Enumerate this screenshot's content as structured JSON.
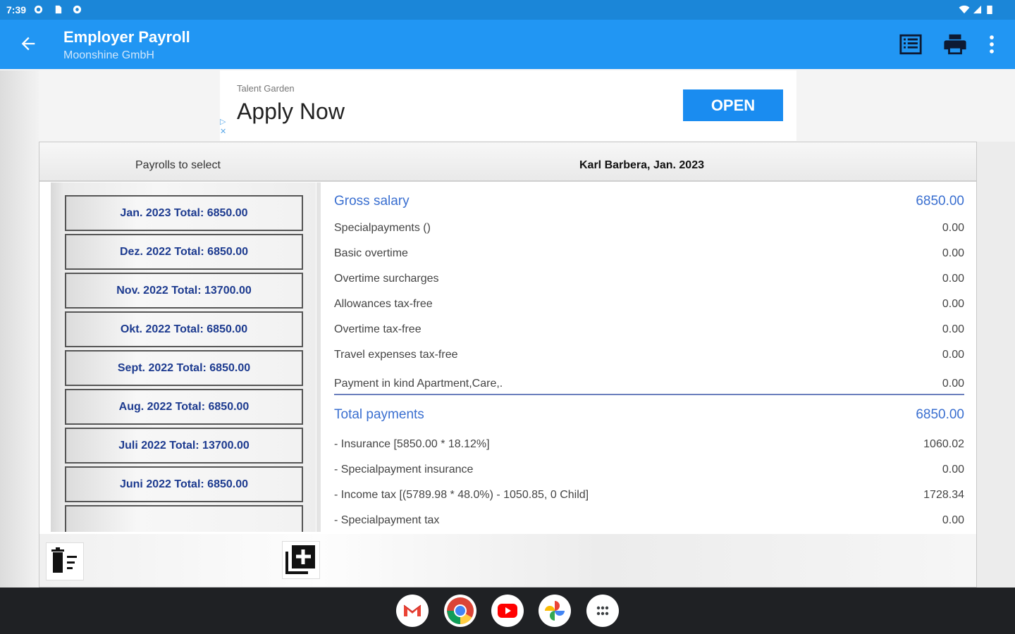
{
  "status_bar": {
    "time": "7:39"
  },
  "app_bar": {
    "title": "Employer Payroll",
    "subtitle": "Moonshine GmbH",
    "icons": [
      "arrow-back-icon",
      "list-view-icon",
      "print-icon",
      "more-vert-icon"
    ]
  },
  "ad": {
    "advertiser": "Talent Garden",
    "headline": "Apply Now",
    "button": "OPEN"
  },
  "panel": {
    "left_header": "Payrolls to select",
    "right_header": "Karl Barbera, Jan. 2023"
  },
  "payrolls": [
    "Jan. 2023 Total: 6850.00",
    "Dez. 2022 Total: 6850.00",
    "Nov. 2022 Total: 13700.00",
    "Okt. 2022 Total: 6850.00",
    "Sept. 2022 Total: 6850.00",
    "Aug. 2022 Total: 6850.00",
    "Juli 2022 Total: 13700.00",
    "Juni 2022 Total: 6850.00"
  ],
  "details": {
    "gross": {
      "label": "Gross salary",
      "value": "6850.00"
    },
    "items": [
      {
        "label": "Specialpayments ()",
        "value": "0.00"
      },
      {
        "label": "Basic overtime",
        "value": "0.00"
      },
      {
        "label": "Overtime surcharges",
        "value": "0.00"
      },
      {
        "label": "Allowances tax-free",
        "value": "0.00"
      },
      {
        "label": "Overtime tax-free",
        "value": "0.00"
      },
      {
        "label": "Travel expenses tax-free",
        "value": "0.00"
      },
      {
        "label": "Payment in kind Apartment,Care,.",
        "value": "0.00"
      }
    ],
    "total": {
      "label": "Total payments",
      "value": "6850.00"
    },
    "deductions": [
      {
        "label": "- Insurance [5850.00 * 18.12%]",
        "value": "1060.02"
      },
      {
        "label": "- Specialpayment insurance",
        "value": "0.00"
      },
      {
        "label": "- Income tax [(5789.98 * 48.0%) - 1050.85, 0 Child]",
        "value": "1728.34"
      },
      {
        "label": "- Specialpayment tax",
        "value": "0.00"
      }
    ]
  },
  "footer": {
    "icons": [
      "delete-list-icon",
      "add-payroll-icon"
    ]
  },
  "dock": {
    "icons": [
      "gmail-icon",
      "chrome-icon",
      "youtube-icon",
      "photos-icon",
      "app-drawer-icon"
    ]
  },
  "colors": {
    "app_bar": "#2196f3",
    "status_bar": "#1b86d8",
    "accent": "#3a6fd0",
    "list_text": "#1c3a8f"
  }
}
